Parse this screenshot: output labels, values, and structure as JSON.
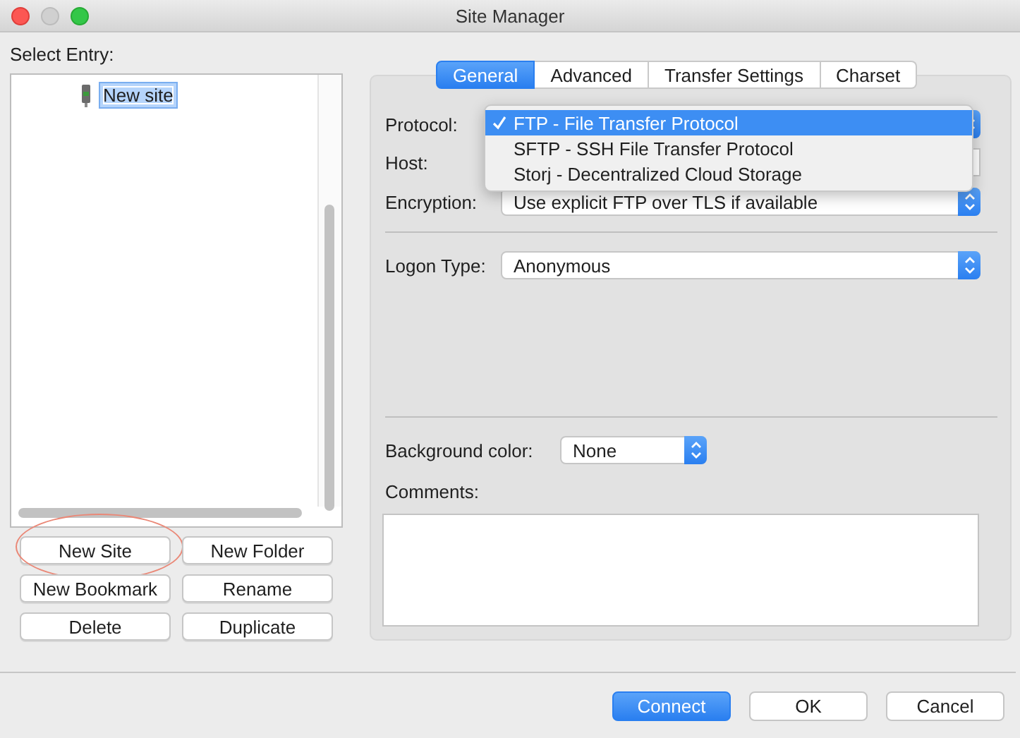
{
  "window": {
    "title": "Site Manager"
  },
  "sidebar": {
    "label": "Select Entry:",
    "tree": [
      {
        "label": "New site",
        "kind": "site",
        "selected": true
      }
    ],
    "buttons": [
      {
        "label": "New Site",
        "highlighted": true
      },
      {
        "label": "New Folder",
        "highlighted": false
      },
      {
        "label": "New Bookmark",
        "highlighted": false
      },
      {
        "label": "Rename",
        "highlighted": false
      },
      {
        "label": "Delete",
        "highlighted": false
      },
      {
        "label": "Duplicate",
        "highlighted": false
      }
    ]
  },
  "tabs": [
    {
      "label": "General",
      "selected": true
    },
    {
      "label": "Advanced",
      "selected": false
    },
    {
      "label": "Transfer Settings",
      "selected": false
    },
    {
      "label": "Charset",
      "selected": false
    }
  ],
  "form": {
    "protocol": {
      "label": "Protocol:",
      "options": [
        {
          "label": "FTP - File Transfer Protocol",
          "selected": true
        },
        {
          "label": "SFTP - SSH File Transfer Protocol",
          "selected": false
        },
        {
          "label": "Storj - Decentralized Cloud Storage",
          "selected": false
        }
      ]
    },
    "host": {
      "label": "Host:"
    },
    "encryption": {
      "label": "Encryption:",
      "value": "Use explicit FTP over TLS if available"
    },
    "logon_type": {
      "label": "Logon Type:",
      "value": "Anonymous"
    },
    "background_color": {
      "label": "Background color:",
      "value": "None"
    },
    "comments": {
      "label": "Comments:"
    }
  },
  "footer_buttons": [
    {
      "label": "Connect",
      "default": true
    },
    {
      "label": "OK",
      "default": false
    },
    {
      "label": "Cancel",
      "default": false
    }
  ]
}
